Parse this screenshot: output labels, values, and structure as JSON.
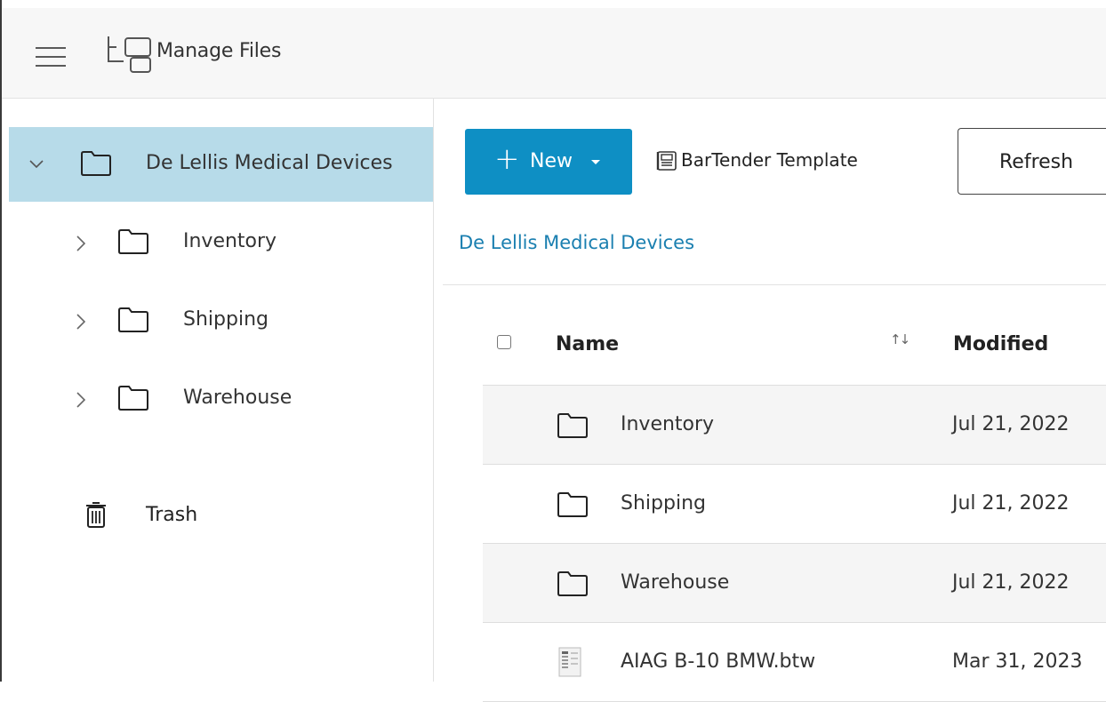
{
  "header": {
    "title": "Manage Files",
    "menu_icon": "hamburger-menu-icon",
    "app_icon": "folder-tree-icon"
  },
  "sidebar": {
    "root": {
      "label": "De Lellis Medical Devices",
      "expanded": true,
      "selected": true
    },
    "children": [
      {
        "label": "Inventory"
      },
      {
        "label": "Shipping"
      },
      {
        "label": "Warehouse"
      }
    ],
    "trash": {
      "label": "Trash"
    }
  },
  "toolbar": {
    "new_label": "New",
    "template_label": "BarTender Template",
    "refresh_label": "Refresh"
  },
  "breadcrumb": "De Lellis Medical Devices",
  "table": {
    "columns": {
      "name": "Name",
      "modified": "Modified",
      "sort_indicator": "↑↓"
    },
    "rows": [
      {
        "name": "Inventory",
        "modified": "Jul 21, 2022",
        "type": "folder"
      },
      {
        "name": "Shipping",
        "modified": "Jul 21, 2022",
        "type": "folder"
      },
      {
        "name": "Warehouse",
        "modified": "Jul 21, 2022",
        "type": "folder"
      },
      {
        "name": "AIAG B-10 BMW.btw",
        "modified": "Mar 31, 2023",
        "type": "btw-file"
      }
    ]
  },
  "colors": {
    "accent": "#0e8fc4",
    "selected_bg": "#b7dbe9",
    "link": "#1a7fb0"
  }
}
